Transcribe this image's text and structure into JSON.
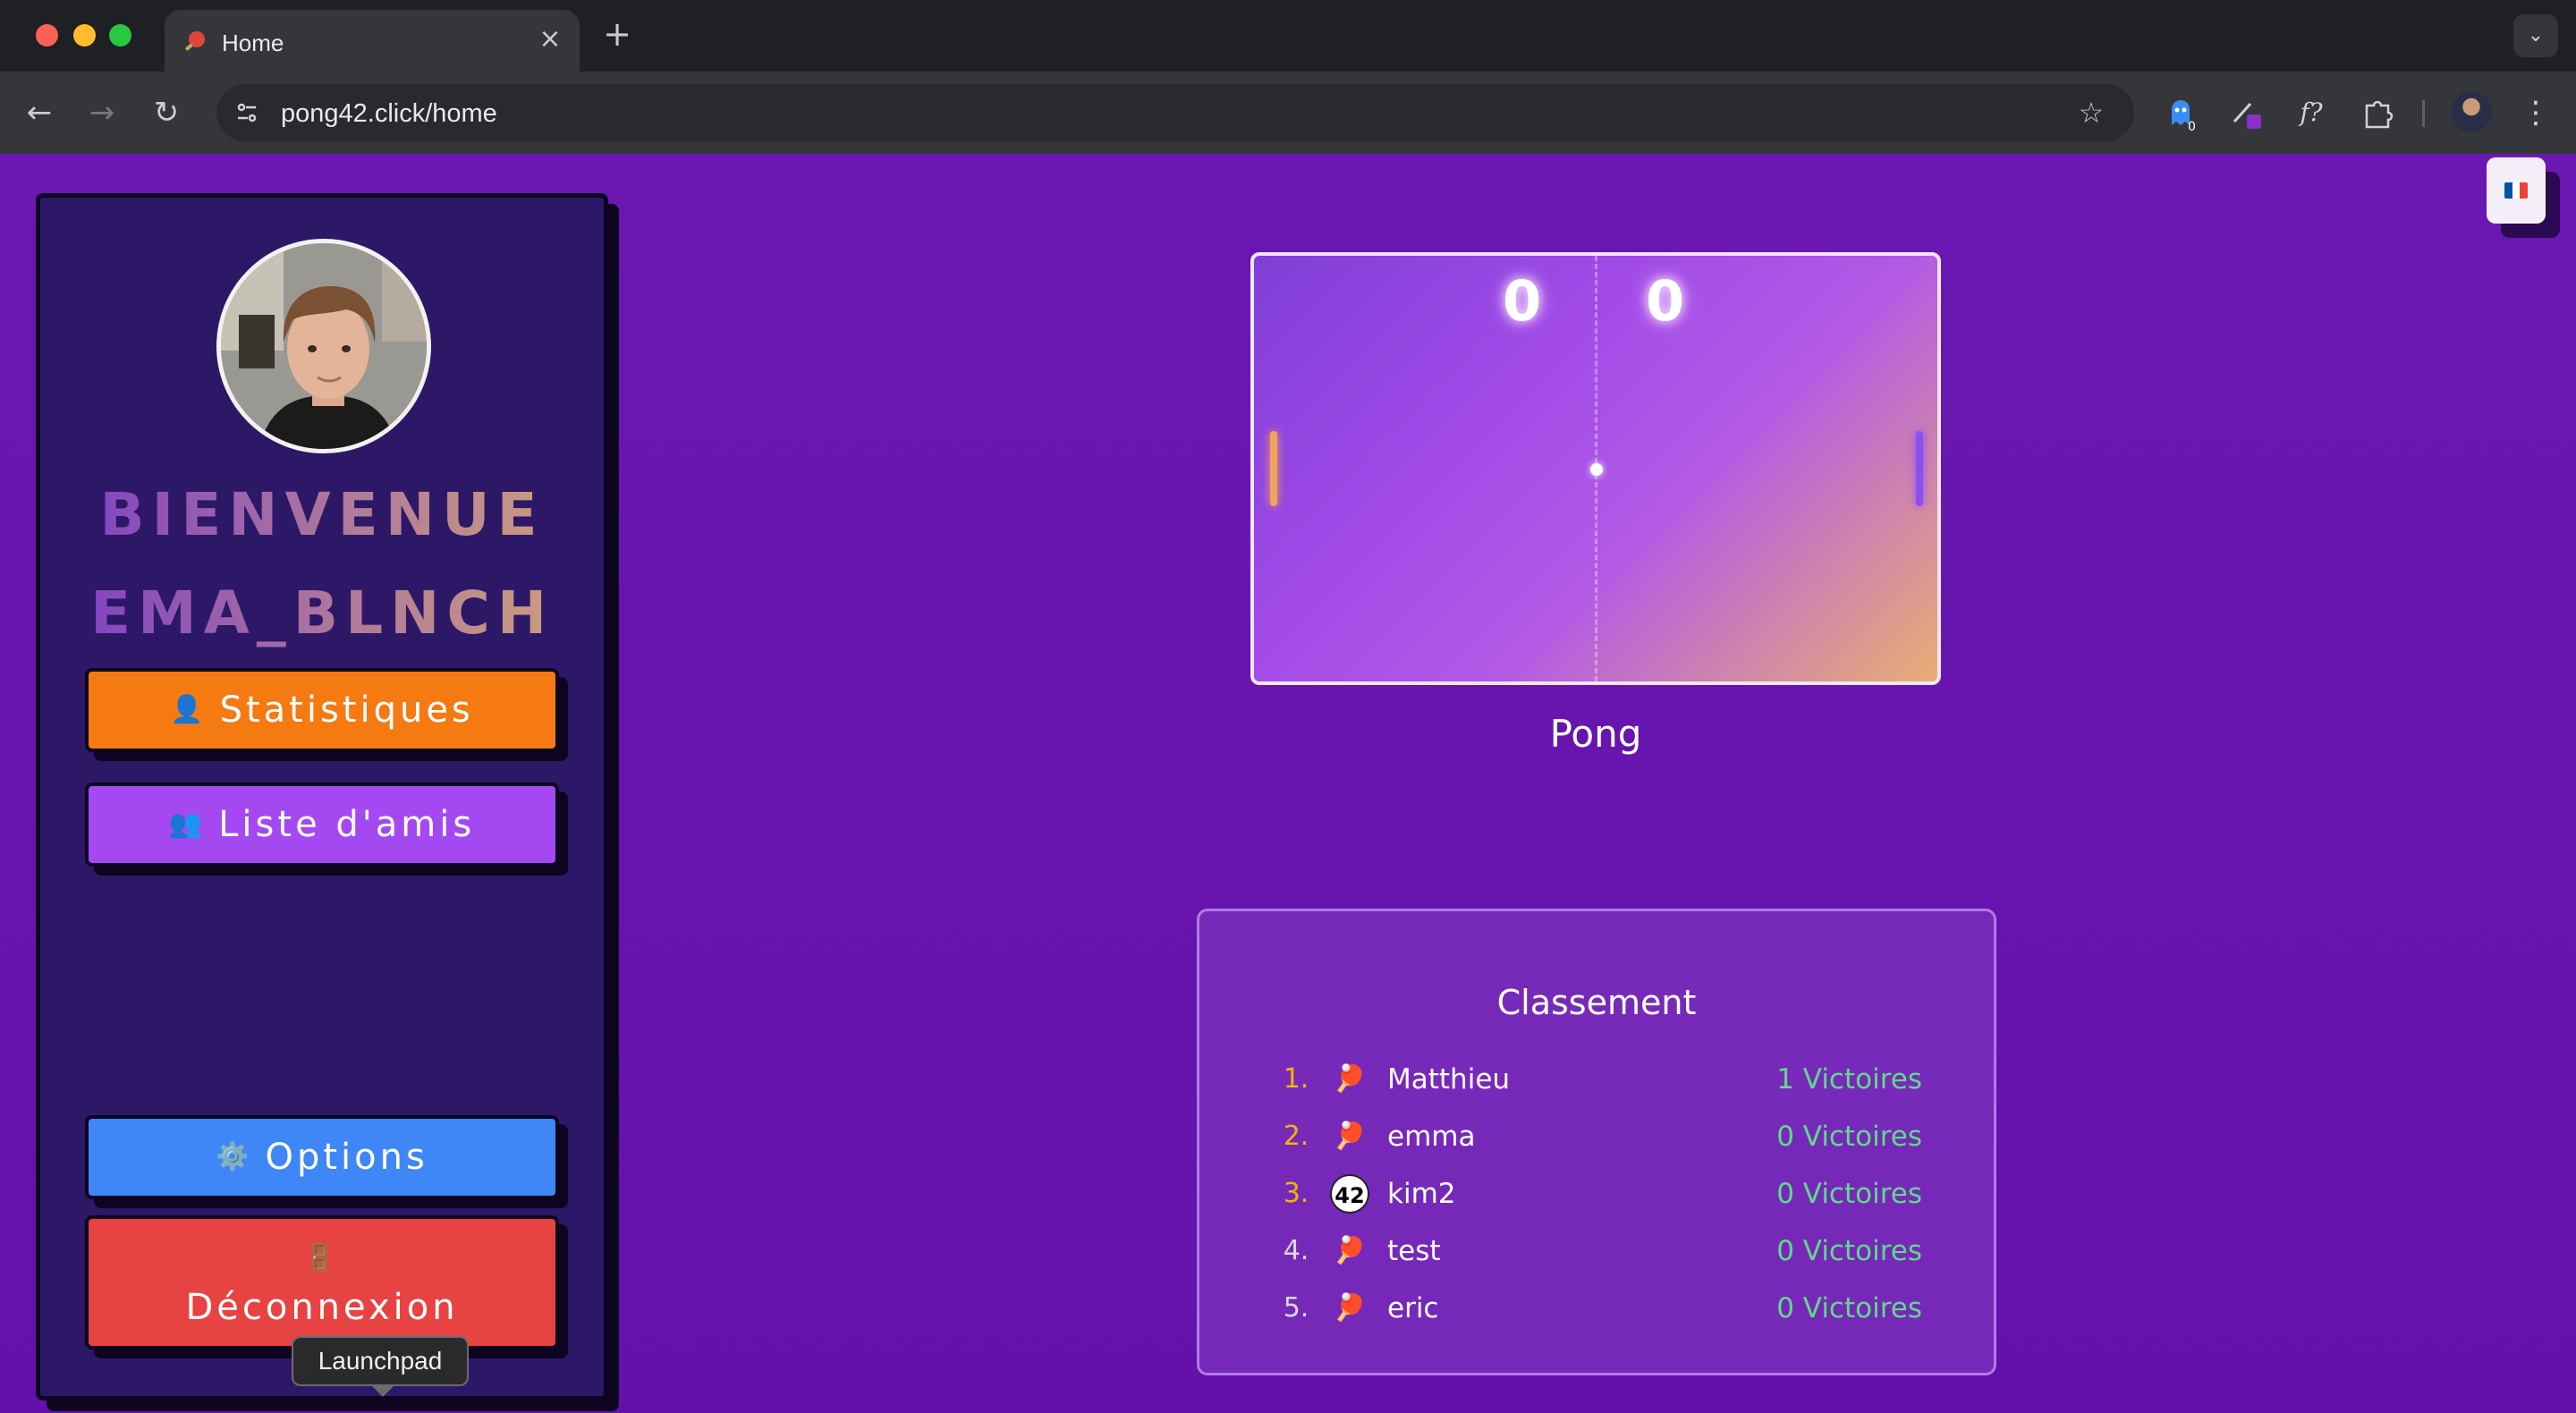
{
  "browser": {
    "tab_title": "Home",
    "url": "pong42.click/home",
    "tab_close": "×",
    "new_tab": "+",
    "ext_badge": "0",
    "ext_fx": "f?"
  },
  "language": {
    "flag_colors": [
      "#0055a4",
      "#ffffff",
      "#ef4135"
    ]
  },
  "sidebar": {
    "welcome_line1": "BIENVENUE",
    "welcome_line2": "EMA_BLNCH",
    "stats_label": "Statistiques",
    "friends_label": "Liste d'amis",
    "options_label": "Options",
    "logout_label": "Déconnexion",
    "stats_icon": "👤",
    "friends_icon": "👥",
    "options_icon": "⚙️",
    "logout_icon": "🚪"
  },
  "tooltip": "Launchpad",
  "game": {
    "score_left": "0",
    "score_right": "0",
    "label": "Pong"
  },
  "leaderboard": {
    "title": "Classement",
    "rows": [
      {
        "rank": "1.",
        "name": "Matthieu",
        "wins": "1 Victoires",
        "rank_color": "#f5b400",
        "icon": "paddle"
      },
      {
        "rank": "2.",
        "name": "emma",
        "wins": "0 Victoires",
        "rank_color": "#f5b400",
        "icon": "paddle"
      },
      {
        "rank": "3.",
        "name": "kim2",
        "wins": "0 Victoires",
        "rank_color": "#f5b400",
        "icon": "42"
      },
      {
        "rank": "4.",
        "name": "test",
        "wins": "0 Victoires",
        "rank_color": "#d9d9d9",
        "icon": "paddle"
      },
      {
        "rank": "5.",
        "name": "eric",
        "wins": "0 Victoires",
        "rank_color": "#d9d9d9",
        "icon": "paddle"
      }
    ]
  },
  "colors": {
    "page_bg": "#6a13b0",
    "stats_btn": "#f57a12",
    "friends_btn": "#a449f2",
    "options_btn": "#3f86f6",
    "logout_btn": "#e64342",
    "wins_text": "#5fd98c"
  }
}
